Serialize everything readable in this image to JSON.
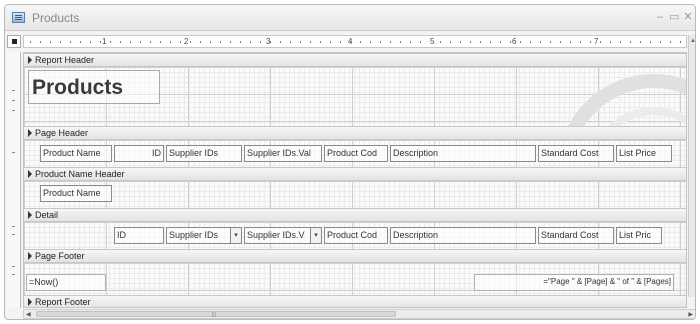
{
  "window": {
    "title": "Products",
    "min_label": "–",
    "restore_label": "▭",
    "close_label": "✕"
  },
  "ruler": {
    "numbers": [
      "1",
      "2",
      "3",
      "4",
      "5",
      "6",
      "7"
    ]
  },
  "sections": {
    "report_header": "Report Header",
    "page_header": "Page Header",
    "group_header": "Product Name Header",
    "detail": "Detail",
    "page_footer": "Page Footer",
    "report_footer": "Report Footer"
  },
  "report_header": {
    "title": "Products"
  },
  "page_header": {
    "labels": [
      "Product Name",
      "ID",
      "Supplier IDs",
      "Supplier IDs.Val",
      "Product Cod",
      "Description",
      "Standard Cost",
      "List Price"
    ]
  },
  "group_header": {
    "field": "Product Name"
  },
  "detail": {
    "id": "ID",
    "supplier_ids": "Supplier IDs",
    "supplier_ids_val": "Supplier IDs.V",
    "product_code": "Product Cod",
    "description": "Description",
    "standard_cost": "Standard Cost",
    "list_price": "List Pric",
    "dropdown_glyph": "▾"
  },
  "page_footer": {
    "date_expr": "=Now()",
    "page_expr": "=\"Page \" & [Page] & \" of \" & [Pages]"
  },
  "scroll": {
    "left_arrow": "◀",
    "right_arrow": "▶",
    "up_arrow": "▲",
    "grip": "|||"
  }
}
